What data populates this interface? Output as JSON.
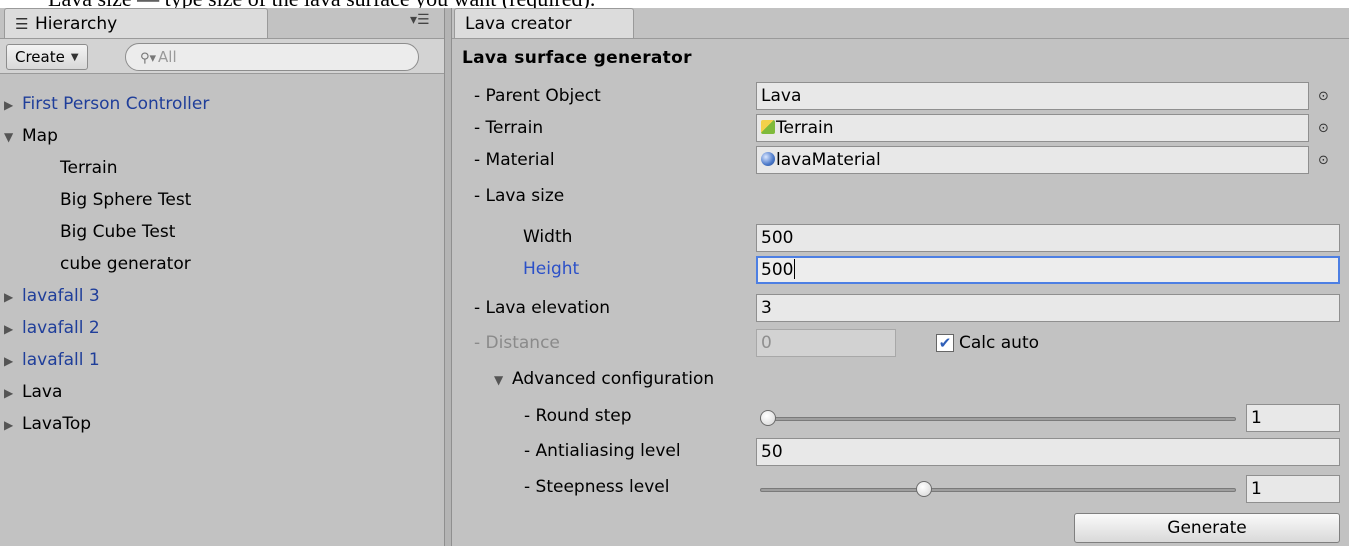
{
  "doc_strip": {
    "text": "Lava size — type size of the lava surface you want (required)."
  },
  "hierarchy": {
    "tab_icon": "☰",
    "tab_label": "Hierarchy",
    "menu_glyph": "▾☰",
    "create_label": "Create",
    "search_placeholder": "All",
    "items": [
      {
        "label": "First Person Controller",
        "arrow": "▶",
        "prefab": true,
        "depth": 0
      },
      {
        "label": "Map",
        "arrow": "▼",
        "prefab": false,
        "depth": 0
      },
      {
        "label": "Terrain",
        "arrow": "",
        "prefab": false,
        "depth": 1
      },
      {
        "label": "Big Sphere Test",
        "arrow": "",
        "prefab": false,
        "depth": 1
      },
      {
        "label": "Big Cube Test",
        "arrow": "",
        "prefab": false,
        "depth": 1
      },
      {
        "label": "cube generator",
        "arrow": "",
        "prefab": false,
        "depth": 1
      },
      {
        "label": "lavafall 3",
        "arrow": "▶",
        "prefab": true,
        "depth": 0
      },
      {
        "label": "lavafall 2",
        "arrow": "▶",
        "prefab": true,
        "depth": 0
      },
      {
        "label": "lavafall 1",
        "arrow": "▶",
        "prefab": true,
        "depth": 0
      },
      {
        "label": "Lava",
        "arrow": "▶",
        "prefab": false,
        "depth": 0
      },
      {
        "label": "LavaTop",
        "arrow": "▶",
        "prefab": false,
        "depth": 0
      }
    ]
  },
  "lava_creator": {
    "tab_label": "Lava creator",
    "section_title": "Lava surface generator",
    "parent_object": {
      "label": "- Parent Object",
      "value": "Lava"
    },
    "terrain": {
      "label": "- Terrain",
      "value": "Terrain"
    },
    "material": {
      "label": "- Material",
      "value": "lavaMaterial"
    },
    "picker_glyph": "⊙",
    "lava_size": {
      "label": "- Lava size",
      "width_label": "Width",
      "width_value": "500",
      "height_label": "Height",
      "height_value": "500"
    },
    "lava_elevation": {
      "label": "- Lava elevation",
      "value": "3"
    },
    "distance": {
      "label": "- Distance",
      "value": "0"
    },
    "calc_auto": {
      "label": "Calc auto",
      "checked": true,
      "check_glyph": "✔"
    },
    "advanced": {
      "label": "Advanced configuration",
      "expanded": true,
      "arrow": "▼",
      "round_step": {
        "label": "- Round step",
        "value": "1",
        "slider_fraction": 0.0
      },
      "antialiasing": {
        "label": "- Antialiasing level",
        "value": "50"
      },
      "steepness": {
        "label": "- Steepness level",
        "value": "1",
        "slider_fraction": 0.34
      }
    },
    "generate_label": "Generate"
  }
}
